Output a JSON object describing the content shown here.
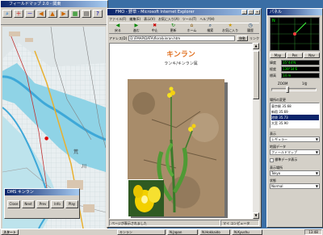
{
  "left_app": {
    "title": "フィールドマップ 2.0 - 関東",
    "toolbar_icons": [
      "search-icon",
      "zoom-in-icon",
      "zoom-out-icon",
      "arrow-left-icon",
      "arrow-up-icon",
      "arrow-right-icon",
      "layer-icon",
      "print-icon",
      "help-icon"
    ]
  },
  "map": {
    "labels": [
      "荒",
      "川"
    ],
    "marker": "●"
  },
  "dialog": {
    "title": "DMS キンラン",
    "buttons": [
      "Close",
      "Next",
      "Prev",
      "Info",
      "Play"
    ]
  },
  "browser": {
    "title": "FMO - 野草 - Microsoft Internet Explorer",
    "menu": [
      "ファイル(F)",
      "編集(E)",
      "表示(V)",
      "お気に入り(A)",
      "ツール(T)",
      "ヘルプ(H)"
    ],
    "toolbar_buttons": [
      "戻る",
      "進む",
      "中止",
      "更新",
      "ホーム",
      "検索",
      "お気に入り",
      "履歴"
    ],
    "address_label": "アドレス(D)",
    "address_value": "D:\\FMAP\\DATA\\flora\\kinran.htm",
    "go_label": "移動",
    "links_label": "リンク",
    "page_title": "キンラン",
    "page_subtitle": "ランキ/キンラン属",
    "status_text": "ページが表示されました",
    "status_zone": "マイ コンピュータ"
  },
  "right_panel": {
    "title": "パネル",
    "compass_value": "N",
    "tabs": [
      "Map",
      "Pos",
      "Nav"
    ],
    "readouts": [
      {
        "label": "緯度",
        "value": "35°44'N"
      },
      {
        "label": "経度",
        "value": "139°34'E"
      },
      {
        "label": "標高",
        "value": "14 m"
      }
    ],
    "zoom_label": "ZOOM",
    "zoom_value": "1倍",
    "section_place": "場所の変更",
    "places": [
      "東京駅 35.68",
      "新宿 35.69",
      "池袋 35.73",
      "大宮 35.90"
    ],
    "section_view": "表示",
    "view_select": "レギュラー",
    "section_data": "地図データ",
    "data_select": "フィールドマップ",
    "checkbox_label": "標準データ表示",
    "section_search": "表示場所",
    "search_select": "Tokyo",
    "section_status": "状態",
    "status_select": "Normal"
  },
  "taskbar": {
    "start": "スタート",
    "items": [
      "キンラン",
      "N.Japan",
      "N.Hokkaido",
      "N.Kyushu"
    ],
    "clock": "13:48"
  },
  "colors": {
    "desktop": "#3a6ea5",
    "titlebar": "#0a246a",
    "water": "#8fd3e6",
    "land": "#e8eef0",
    "river": "#3ea8d8",
    "page_heading": "#e07020"
  }
}
